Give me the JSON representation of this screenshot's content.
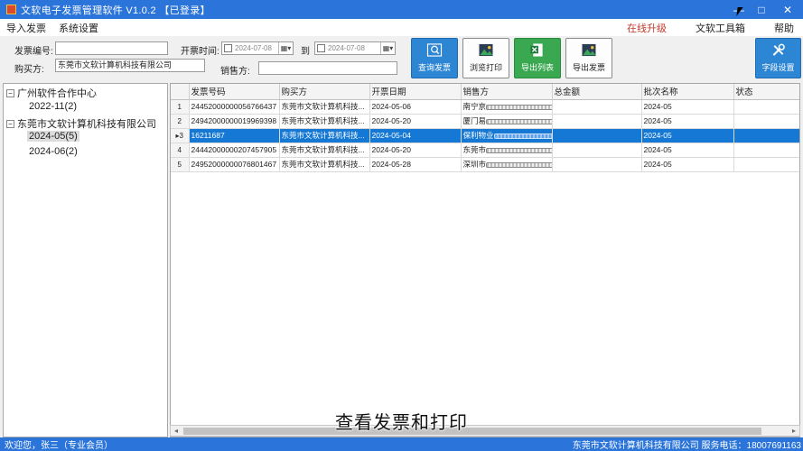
{
  "window": {
    "title": "文软电子发票管理软件 V1.0.2 【已登录】",
    "minimize_glyph": "—",
    "maximize_glyph": "□",
    "close_glyph": "✕"
  },
  "menu": {
    "left": [
      "导入发票",
      "系统设置"
    ],
    "upgrade": "在线升级",
    "tools": "文软工具箱",
    "help": "帮助"
  },
  "filters": {
    "invoice_no_label": "发票编号:",
    "invoice_no_value": "",
    "buyer_label": "购买方:",
    "buyer_value": "东莞市文软计算机科技有限公司",
    "issue_time_label": "开票时间:",
    "date_from": "2024-07-08",
    "to_label": "到",
    "date_to": "2024-07-08",
    "seller_label": "销售方:",
    "seller_value": ""
  },
  "buttons": {
    "query": "查询发票",
    "preview_print": "浏览打印",
    "export_list": "导出列表",
    "export_invoice": "导出发票",
    "field_settings": "字段设置"
  },
  "tree": [
    {
      "label": "广州软件合作中心",
      "toggle": "−",
      "level": 0
    },
    {
      "label": "2022-11(2)",
      "level": 1
    },
    {
      "label": "东莞市文软计算机科技有限公司",
      "toggle": "−",
      "level": 0
    },
    {
      "label": "2024-05(5)",
      "level": 1,
      "selected": true
    },
    {
      "label": "2024-06(2)",
      "level": 1
    }
  ],
  "table": {
    "columns": [
      "发票号码",
      "购买方",
      "开票日期",
      "销售方",
      "总金额",
      "批次名称",
      "状态"
    ],
    "rows": [
      {
        "n": "1",
        "invoice_no": "24452000000056766437",
        "buyer": "东莞市文软计算机科技...",
        "date": "2024-05-06",
        "seller": "南宁京",
        "total": "",
        "batch": "2024-05",
        "status": ""
      },
      {
        "n": "2",
        "invoice_no": "24942000000019969398",
        "buyer": "东莞市文软计算机科技...",
        "date": "2024-05-20",
        "seller": "厦门易",
        "total": "",
        "batch": "2024-05",
        "status": ""
      },
      {
        "n": "3",
        "invoice_no": "16211687",
        "buyer": "东莞市文软计算机科技...",
        "date": "2024-05-04",
        "seller": "保利物业",
        "total": "",
        "batch": "2024-05",
        "status": "",
        "selected": true
      },
      {
        "n": "4",
        "invoice_no": "24442000000207457905",
        "buyer": "东莞市文软计算机科技...",
        "date": "2024-05-20",
        "seller": "东莞市",
        "total": "",
        "batch": "2024-05",
        "status": ""
      },
      {
        "n": "5",
        "invoice_no": "24952000000076801467",
        "buyer": "东莞市文软计算机科技...",
        "date": "2024-05-28",
        "seller": "深圳市",
        "total": "",
        "batch": "2024-05",
        "status": ""
      }
    ]
  },
  "caption": "查看发票和打印",
  "status": {
    "left": "欢迎您，张三（专业会员）",
    "right": "东莞市文软计算机科技有限公司  服务电话：18007691163"
  }
}
